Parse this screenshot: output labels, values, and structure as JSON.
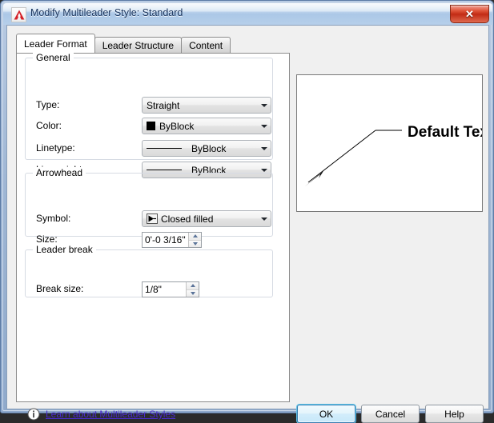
{
  "window": {
    "title": "Modify Multileader Style: Standard",
    "app_icon": "autocad-a-icon",
    "close_label": "✕"
  },
  "tabs": [
    {
      "label": "Leader Format",
      "active": true
    },
    {
      "label": "Leader Structure",
      "active": false
    },
    {
      "label": "Content",
      "active": false
    }
  ],
  "groups": {
    "general": {
      "title": "General",
      "fields": {
        "type": {
          "label": "Type:",
          "value": "Straight"
        },
        "color": {
          "label": "Color:",
          "value": "ByBlock",
          "swatch": "#000000"
        },
        "linetype": {
          "label": "Linetype:",
          "value": "ByBlock"
        },
        "lineweight": {
          "label": "Lineweight:",
          "value": "ByBlock"
        }
      }
    },
    "arrowhead": {
      "title": "Arrowhead",
      "fields": {
        "symbol": {
          "label": "Symbol:",
          "value": "Closed filled"
        },
        "size": {
          "label": "Size:",
          "value": "0'-0 3/16\""
        }
      }
    },
    "leader_break": {
      "title": "Leader break",
      "fields": {
        "break_size": {
          "label": "Break size:",
          "value": "1/8\""
        }
      }
    }
  },
  "preview": {
    "text": "Default Text",
    "description": "multileader-preview"
  },
  "footer": {
    "info_icon": "info-icon",
    "learn_link": "Learn about Multileader Styles",
    "buttons": {
      "ok": "OK",
      "cancel": "Cancel",
      "help": "Help"
    }
  },
  "colors": {
    "title_text": "#16325c",
    "link": "#4a2ccd",
    "default_button_glow": "#5fc6ea",
    "close_button": "#c22b14"
  }
}
